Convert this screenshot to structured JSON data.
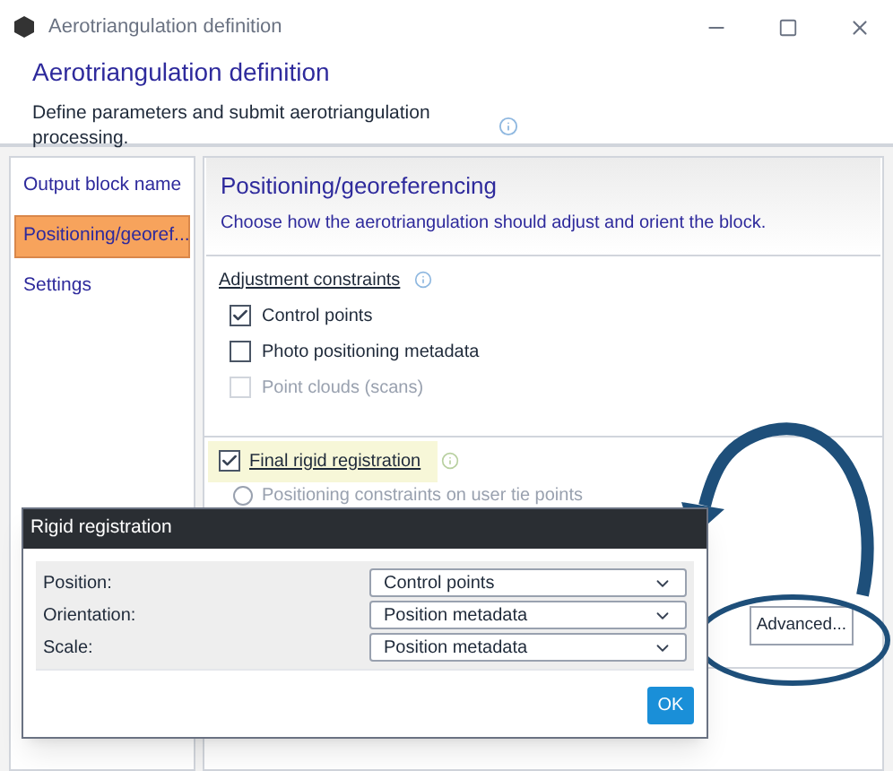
{
  "window": {
    "title": "Aerotriangulation definition"
  },
  "header": {
    "title": "Aerotriangulation definition",
    "description": "Define parameters and submit aerotriangulation processing."
  },
  "sidebar": {
    "items": [
      {
        "label": "Output block name",
        "selected": false
      },
      {
        "label": "Positioning/georef...",
        "selected": true
      },
      {
        "label": "Settings",
        "selected": false
      }
    ]
  },
  "panel": {
    "title": "Positioning/georeferencing",
    "subtitle": "Choose how the aerotriangulation should adjust and orient the block.",
    "constraints": {
      "label": "Adjustment constraints",
      "options": [
        {
          "label": "Control points",
          "checked": true,
          "disabled": false
        },
        {
          "label": "Photo positioning metadata",
          "checked": false,
          "disabled": false
        },
        {
          "label": "Point clouds (scans)",
          "checked": false,
          "disabled": true
        }
      ]
    },
    "rigid": {
      "label": "Final rigid registration",
      "checked": true,
      "highlighted": true
    },
    "radio": {
      "label": "Positioning constraints on user tie points",
      "selected": false
    },
    "advanced_button": "Advanced..."
  },
  "dialog": {
    "title": "Rigid registration",
    "rows": [
      {
        "label": "Position:",
        "value": "Control points"
      },
      {
        "label": "Orientation:",
        "value": "Position metadata"
      },
      {
        "label": "Scale:",
        "value": "Position metadata"
      }
    ],
    "ok": "OK"
  }
}
